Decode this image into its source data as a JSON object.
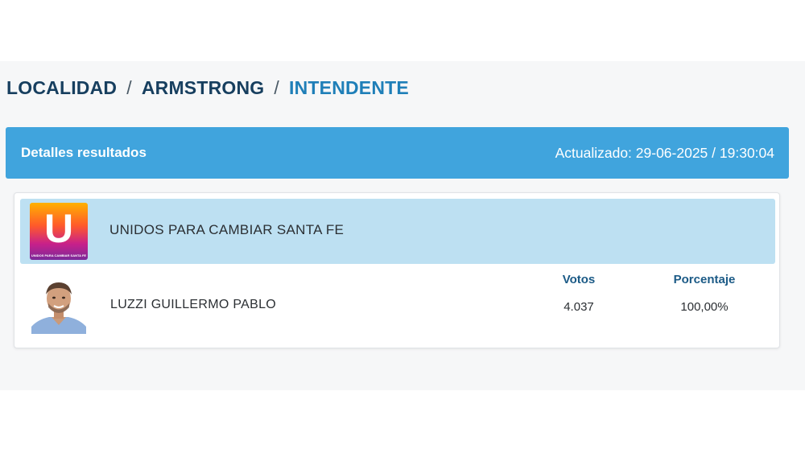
{
  "breadcrumb": {
    "level1": "LOCALIDAD",
    "level2": "ARMSTRONG",
    "current": "INTENDENTE",
    "separator": "/"
  },
  "results_header": {
    "title": "Detalles resultados",
    "updated": "Actualizado: 29-06-2025 / 19:30:04"
  },
  "party": {
    "name": "UNIDOS PARA CAMBIAR SANTA FE",
    "logo_letter": "U",
    "logo_caption": "UNIDOS PARA CAMBIAR SANTA FE"
  },
  "columns": {
    "votes_label": "Votos",
    "percent_label": "Porcentaje"
  },
  "candidate": {
    "name": "LUZZI GUILLERMO PABLO",
    "votes": "4.037",
    "percent": "100,00%"
  },
  "colors": {
    "header_bg": "#40a4dd",
    "party_row_bg": "#bde0f2",
    "breadcrumb_dark": "#173f5f",
    "breadcrumb_current": "#1f7fb8",
    "column_header": "#1b5a86"
  }
}
